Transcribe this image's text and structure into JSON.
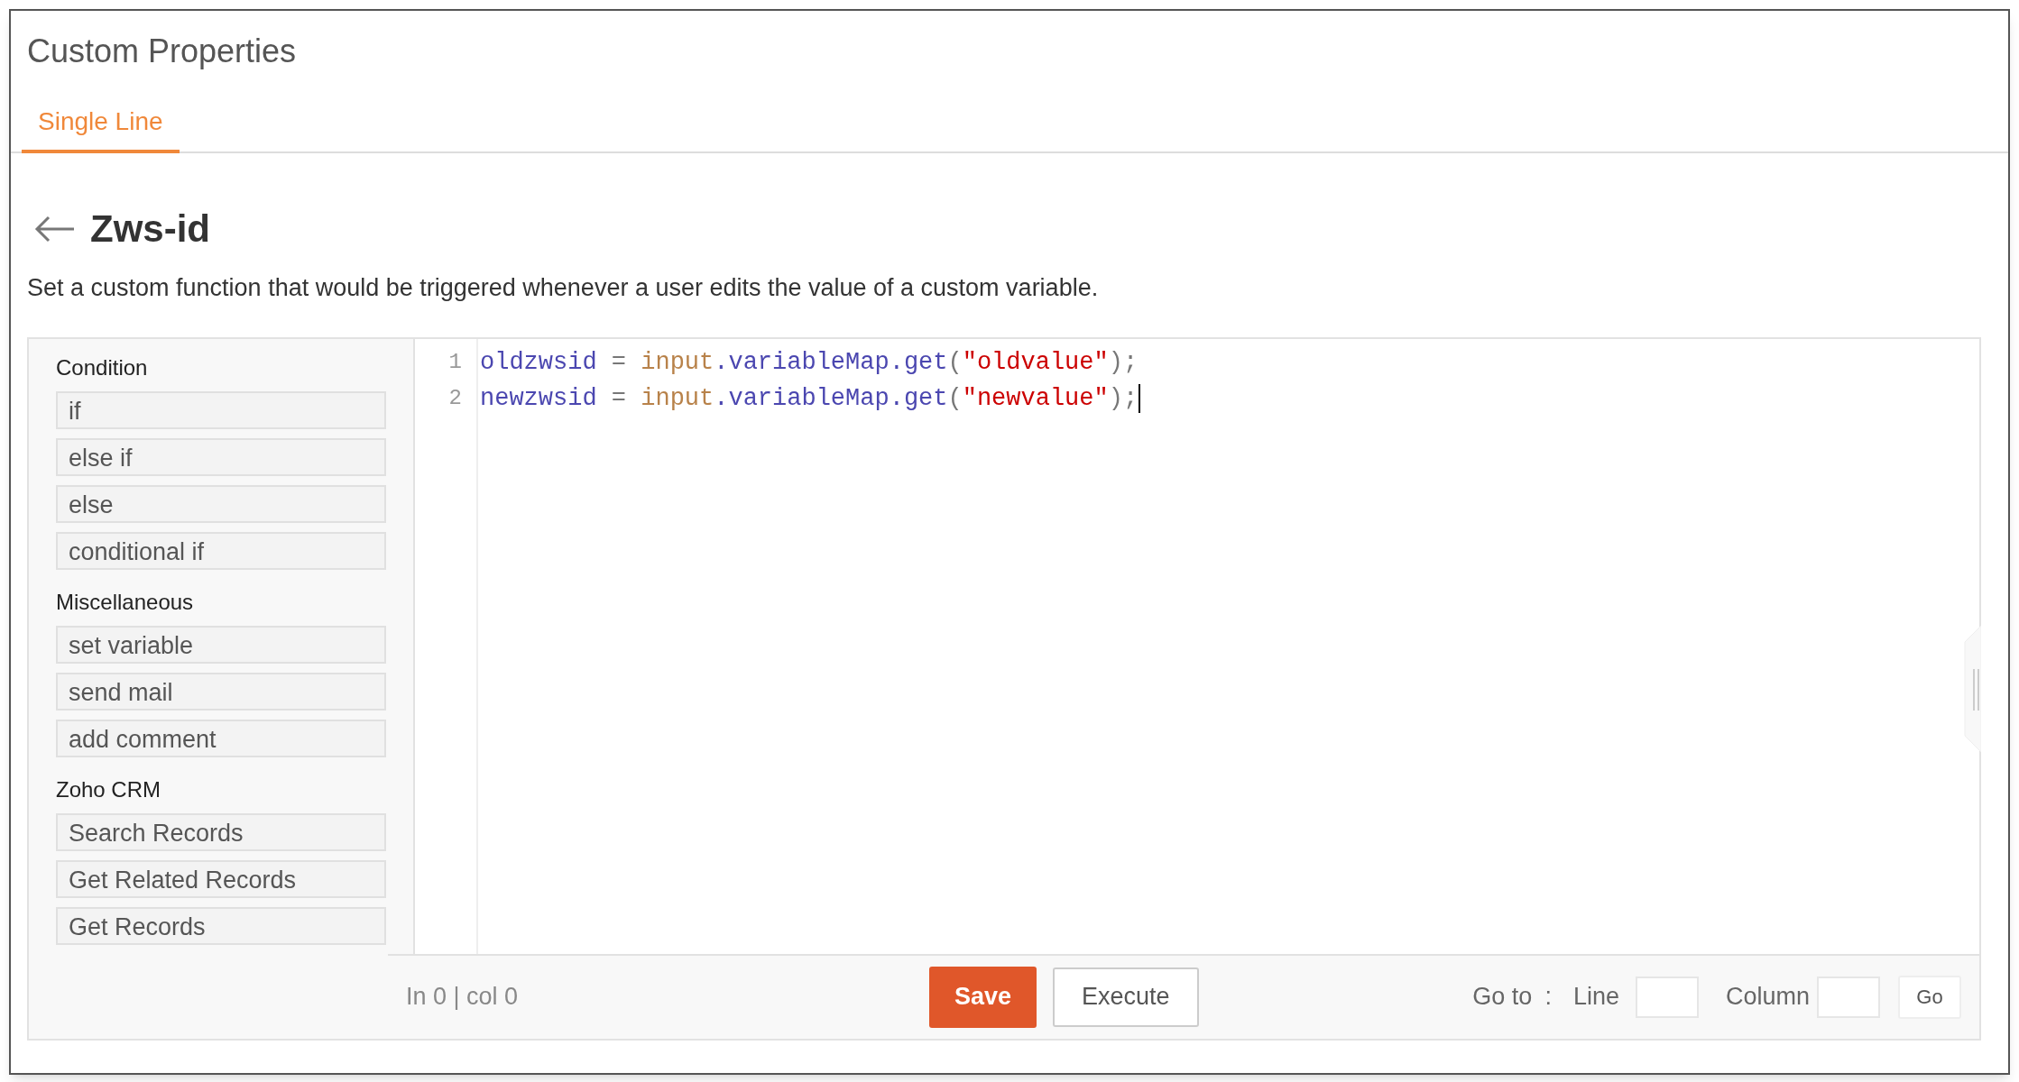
{
  "page_title": "Custom Properties",
  "tabs": [
    {
      "label": "Single Line",
      "selected": true
    }
  ],
  "heading": "Zws-id",
  "description": "Set a custom function that would be triggered whenever a user edits the value of a custom variable.",
  "sidebar": {
    "groups": [
      {
        "title": "Condition",
        "items": [
          "if",
          "else if",
          "else",
          "conditional if"
        ]
      },
      {
        "title": "Miscellaneous",
        "items": [
          "set variable",
          "send mail",
          "add comment"
        ]
      },
      {
        "title": "Zoho CRM",
        "items": [
          "Search Records",
          "Get Related Records",
          "Get Records"
        ]
      }
    ]
  },
  "editor": {
    "lines": [
      {
        "number": "1",
        "cursor": false,
        "tokens": [
          {
            "kind": "var",
            "text": "oldzwsid"
          },
          {
            "kind": "op",
            "text": " = "
          },
          {
            "kind": "obj",
            "text": "input"
          },
          {
            "kind": "var",
            "text": ".variableMap.get"
          },
          {
            "kind": "punc",
            "text": "("
          },
          {
            "kind": "str",
            "text": "\"oldvalue\""
          },
          {
            "kind": "punc",
            "text": ");"
          }
        ]
      },
      {
        "number": "2",
        "cursor": true,
        "tokens": [
          {
            "kind": "var",
            "text": "newzwsid"
          },
          {
            "kind": "op",
            "text": " = "
          },
          {
            "kind": "obj",
            "text": "input"
          },
          {
            "kind": "var",
            "text": ".variableMap.get"
          },
          {
            "kind": "punc",
            "text": "("
          },
          {
            "kind": "str",
            "text": "\"newvalue\""
          },
          {
            "kind": "punc",
            "text": ");"
          }
        ]
      }
    ]
  },
  "status_bar": {
    "position": "In 0 | col 0",
    "save": "Save",
    "execute": "Execute",
    "goto_label": "Go to",
    "goto_colon": ":",
    "line_label": "Line",
    "column_label": "Column",
    "go": "Go"
  }
}
